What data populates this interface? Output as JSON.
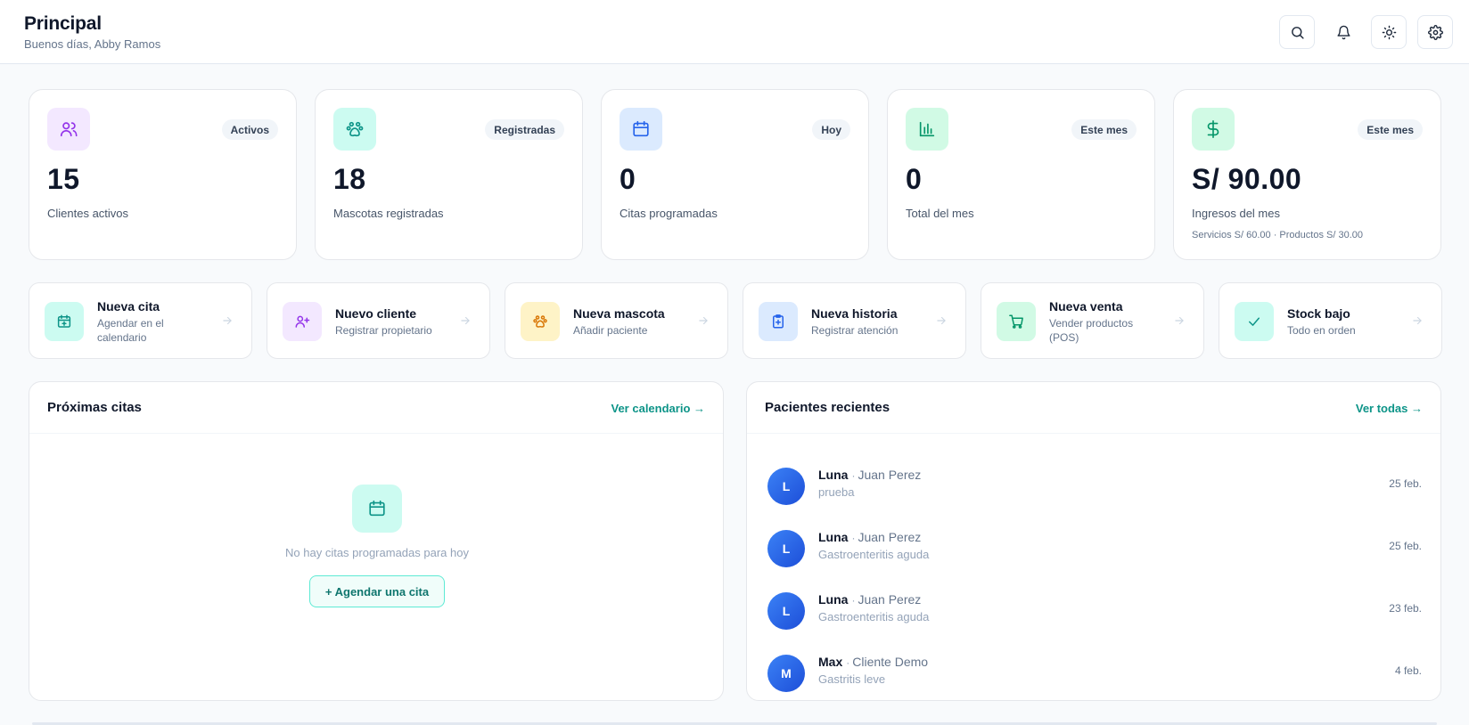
{
  "header": {
    "title": "Principal",
    "greeting": "Buenos días, Abby Ramos",
    "icons": [
      "search-icon",
      "bell-icon",
      "sun-icon",
      "gear-icon"
    ]
  },
  "stats": [
    {
      "badge": "Activos",
      "value": "15",
      "label": "Clientes activos",
      "sub": "",
      "icon": "users-icon",
      "color": "#9333ea",
      "bg": "#f3e8ff"
    },
    {
      "badge": "Registradas",
      "value": "18",
      "label": "Mascotas registradas",
      "sub": "",
      "icon": "paw-icon",
      "color": "#0d9488",
      "bg": "#ccfbf1"
    },
    {
      "badge": "Hoy",
      "value": "0",
      "label": "Citas programadas",
      "sub": "",
      "icon": "calendar-icon",
      "color": "#2563eb",
      "bg": "#dbeafe"
    },
    {
      "badge": "Este mes",
      "value": "0",
      "label": "Total del mes",
      "sub": "",
      "icon": "bar-chart-icon",
      "color": "#059669",
      "bg": "#d1fae5"
    },
    {
      "badge": "Este mes",
      "value": "S/ 90.00",
      "label": "Ingresos del mes",
      "sub": "Servicios S/ 60.00 · Productos S/ 30.00",
      "icon": "dollar-icon",
      "color": "#059669",
      "bg": "#d1fae5"
    }
  ],
  "quick_actions": [
    {
      "title": "Nueva cita",
      "sub": "Agendar en el calendario",
      "icon": "calendar-plus-icon",
      "color": "#0d9488",
      "bg": "#ccfbf1"
    },
    {
      "title": "Nuevo cliente",
      "sub": "Registrar propietario",
      "icon": "user-plus-icon",
      "color": "#9333ea",
      "bg": "#f3e8ff"
    },
    {
      "title": "Nueva mascota",
      "sub": "Añadir paciente",
      "icon": "paw-icon",
      "color": "#d97706",
      "bg": "#fef3c7"
    },
    {
      "title": "Nueva historia",
      "sub": "Registrar atención",
      "icon": "clipboard-plus-icon",
      "color": "#2563eb",
      "bg": "#dbeafe"
    },
    {
      "title": "Nueva venta",
      "sub": "Vender productos (POS)",
      "icon": "cart-icon",
      "color": "#059669",
      "bg": "#d1fae5"
    },
    {
      "title": "Stock bajo",
      "sub": "Todo en orden",
      "icon": "check-icon",
      "color": "#0d9488",
      "bg": "#ccfbf1"
    }
  ],
  "appointments": {
    "title": "Próximas citas",
    "link": "Ver calendario →",
    "empty_text": "No hay citas programadas para hoy",
    "empty_button": "+ Agendar una cita"
  },
  "patients": {
    "title": "Pacientes recientes",
    "link": "Ver todas →",
    "items": [
      {
        "initial": "L",
        "name": "Luna",
        "owner": "Juan Perez",
        "reason": "prueba",
        "date": "25 feb."
      },
      {
        "initial": "L",
        "name": "Luna",
        "owner": "Juan Perez",
        "reason": "Gastroenteritis aguda",
        "date": "25 feb."
      },
      {
        "initial": "L",
        "name": "Luna",
        "owner": "Juan Perez",
        "reason": "Gastroenteritis aguda",
        "date": "23 feb."
      },
      {
        "initial": "M",
        "name": "Max",
        "owner": "Cliente Demo",
        "reason": "Gastritis leve",
        "date": "4 feb."
      }
    ]
  }
}
